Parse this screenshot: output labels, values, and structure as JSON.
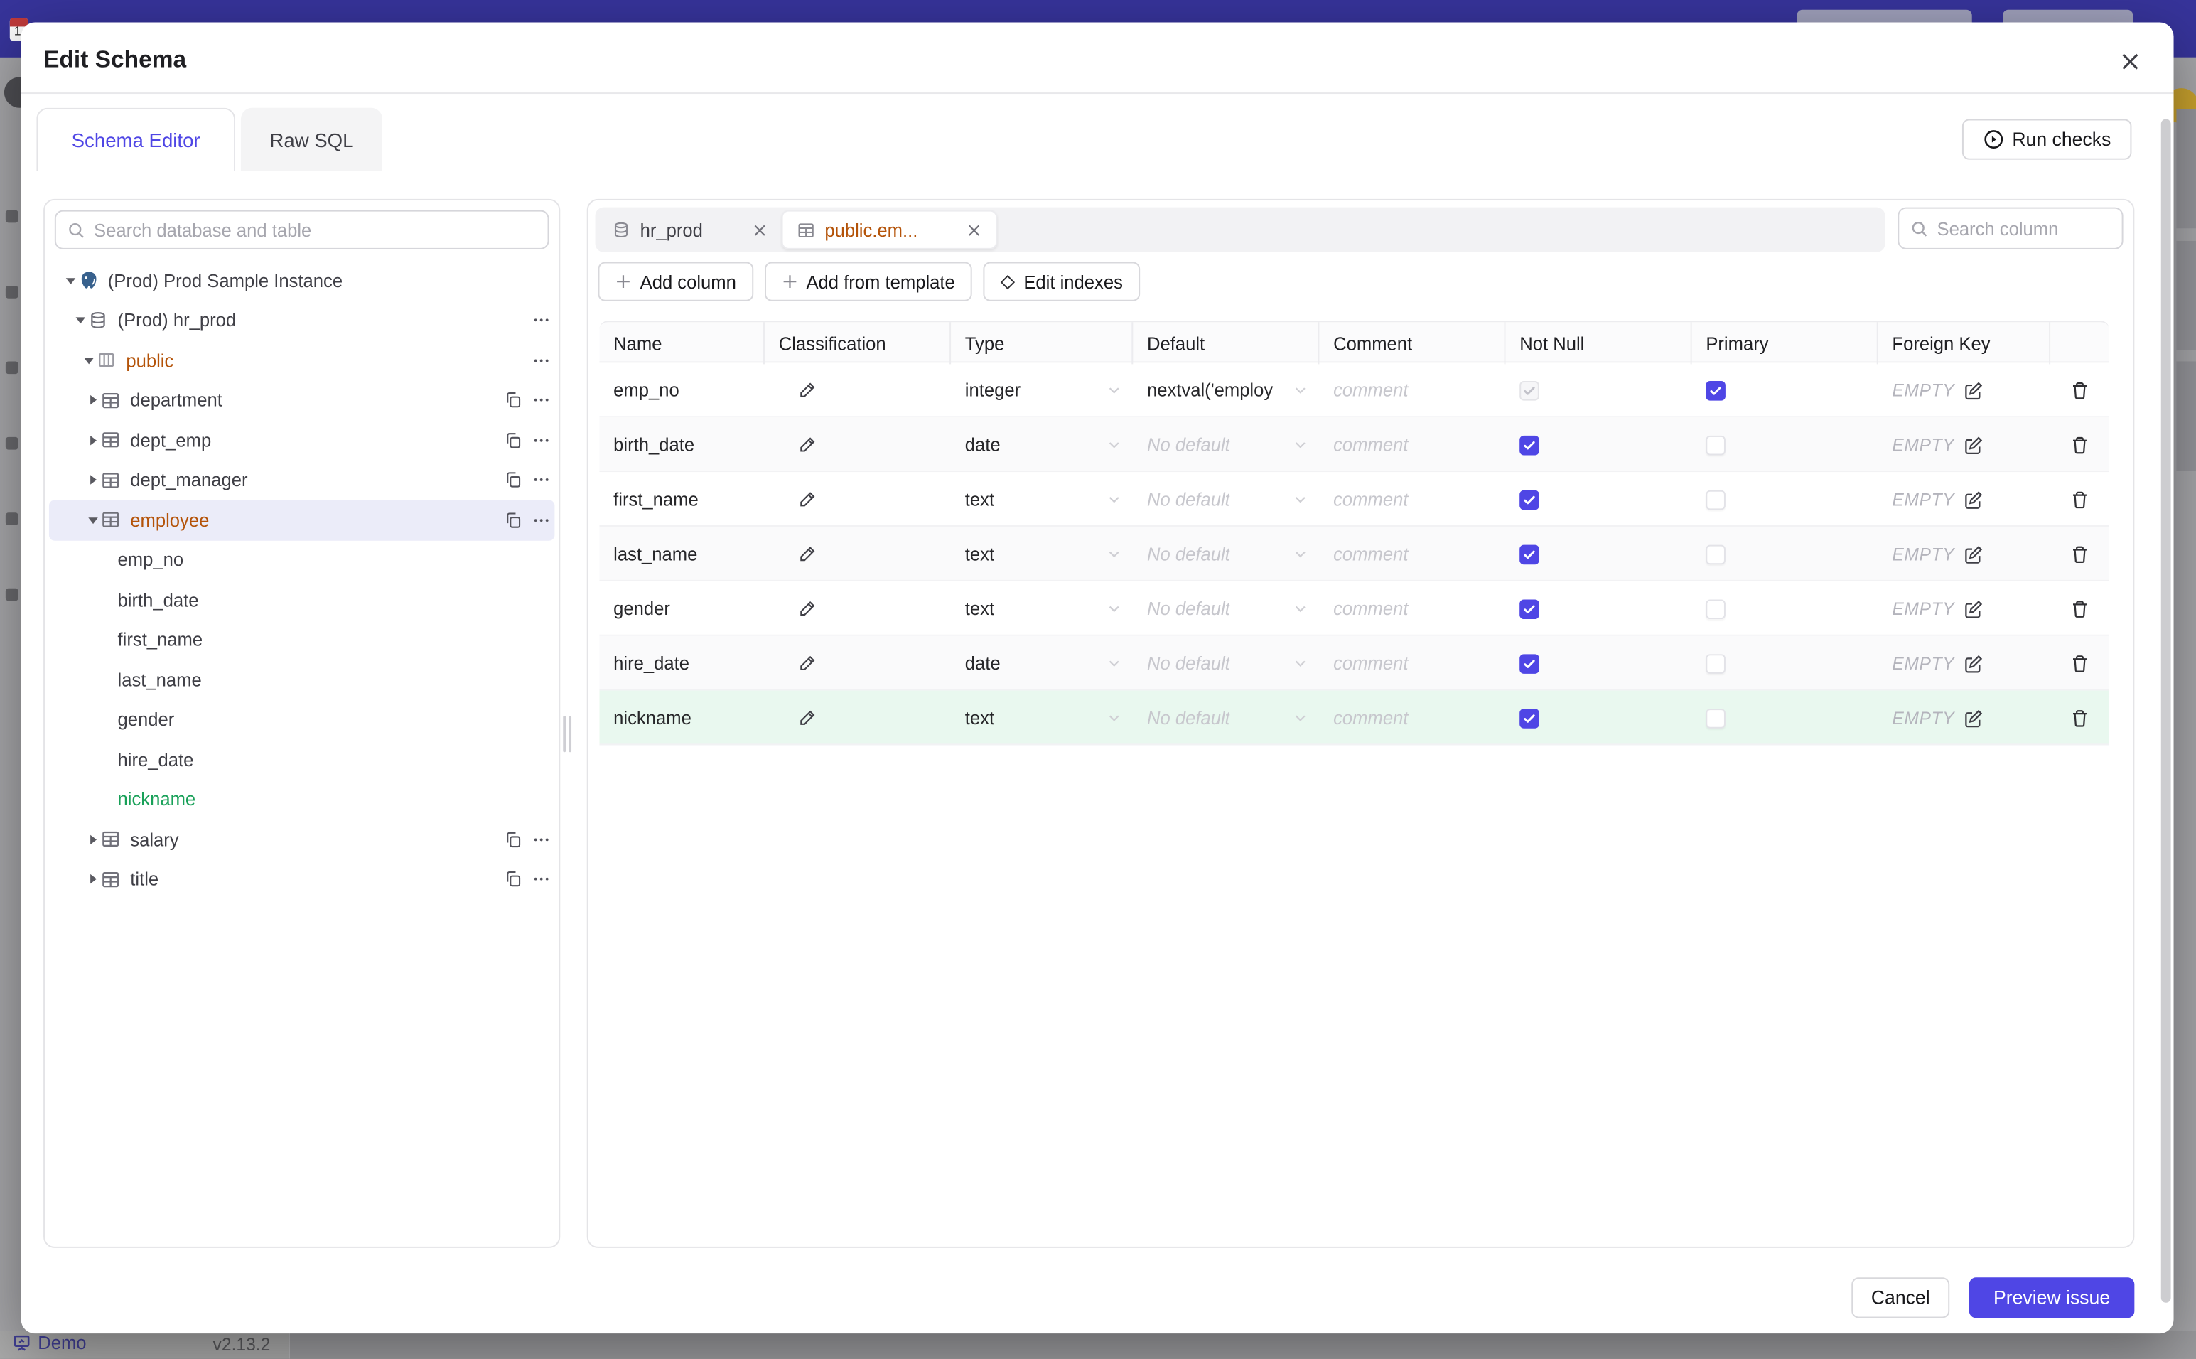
{
  "modal": {
    "title": "Edit Schema"
  },
  "header_tabs": {
    "schema_editor": "Schema Editor",
    "raw_sql": "Raw SQL"
  },
  "run_checks_label": "Run checks",
  "sidebar": {
    "search_placeholder": "Search database and table",
    "tree": [
      {
        "level": 0,
        "caret": "down",
        "icon": "postgres",
        "label": "(Prod) Prod Sample Instance",
        "color": "default",
        "selected": false,
        "actions": []
      },
      {
        "level": 1,
        "caret": "down",
        "icon": "database",
        "label": "(Prod) hr_prod",
        "color": "default",
        "selected": false,
        "actions": [
          "menu"
        ]
      },
      {
        "level": 2,
        "caret": "down",
        "icon": "schema",
        "label": "public",
        "color": "amber",
        "selected": false,
        "actions": [
          "menu"
        ]
      },
      {
        "level": 3,
        "caret": "right",
        "icon": "table",
        "label": "department",
        "color": "default",
        "selected": false,
        "actions": [
          "copy",
          "menu"
        ]
      },
      {
        "level": 3,
        "caret": "right",
        "icon": "table",
        "label": "dept_emp",
        "color": "default",
        "selected": false,
        "actions": [
          "copy",
          "menu"
        ]
      },
      {
        "level": 3,
        "caret": "right",
        "icon": "table",
        "label": "dept_manager",
        "color": "default",
        "selected": false,
        "actions": [
          "copy",
          "menu"
        ]
      },
      {
        "level": 3,
        "caret": "down",
        "icon": "table",
        "label": "employee",
        "color": "amber",
        "selected": true,
        "actions": [
          "copy",
          "menu"
        ]
      },
      {
        "level": 4,
        "caret": null,
        "icon": null,
        "label": "emp_no",
        "color": "default",
        "selected": false,
        "actions": []
      },
      {
        "level": 4,
        "caret": null,
        "icon": null,
        "label": "birth_date",
        "color": "default",
        "selected": false,
        "actions": []
      },
      {
        "level": 4,
        "caret": null,
        "icon": null,
        "label": "first_name",
        "color": "default",
        "selected": false,
        "actions": []
      },
      {
        "level": 4,
        "caret": null,
        "icon": null,
        "label": "last_name",
        "color": "default",
        "selected": false,
        "actions": []
      },
      {
        "level": 4,
        "caret": null,
        "icon": null,
        "label": "gender",
        "color": "default",
        "selected": false,
        "actions": []
      },
      {
        "level": 4,
        "caret": null,
        "icon": null,
        "label": "hire_date",
        "color": "default",
        "selected": false,
        "actions": []
      },
      {
        "level": 4,
        "caret": null,
        "icon": null,
        "label": "nickname",
        "color": "green",
        "selected": false,
        "actions": []
      },
      {
        "level": 3,
        "caret": "right",
        "icon": "table",
        "label": "salary",
        "color": "default",
        "selected": false,
        "actions": [
          "copy",
          "menu"
        ]
      },
      {
        "level": 3,
        "caret": "right",
        "icon": "table",
        "label": "title",
        "color": "default",
        "selected": false,
        "actions": [
          "copy",
          "menu"
        ]
      }
    ]
  },
  "editor": {
    "tabs": [
      {
        "label": "hr_prod",
        "icon": "database",
        "active": false
      },
      {
        "label": "public.em...",
        "icon": "table",
        "active": true
      }
    ],
    "search_placeholder": "Search column",
    "actions": [
      {
        "icon": "plus",
        "label": "Add column"
      },
      {
        "icon": "plus",
        "label": "Add from template"
      },
      {
        "icon": "diamond",
        "label": "Edit indexes"
      }
    ],
    "table": {
      "columns": [
        "Name",
        "Classification",
        "Type",
        "Default",
        "Comment",
        "Not Null",
        "Primary",
        "Foreign Key",
        ""
      ],
      "comment_placeholder": "comment",
      "rows": [
        {
          "name": "emp_no",
          "type": "integer",
          "default": "nextval('employ",
          "default_is_placeholder": false,
          "not_null": "on-disabled",
          "primary": "on",
          "foreign_key": "EMPTY",
          "added": false
        },
        {
          "name": "birth_date",
          "type": "date",
          "default": "No default",
          "default_is_placeholder": true,
          "not_null": "on",
          "primary": "off",
          "foreign_key": "EMPTY",
          "added": false
        },
        {
          "name": "first_name",
          "type": "text",
          "default": "No default",
          "default_is_placeholder": true,
          "not_null": "on",
          "primary": "off",
          "foreign_key": "EMPTY",
          "added": false
        },
        {
          "name": "last_name",
          "type": "text",
          "default": "No default",
          "default_is_placeholder": true,
          "not_null": "on",
          "primary": "off",
          "foreign_key": "EMPTY",
          "added": false
        },
        {
          "name": "gender",
          "type": "text",
          "default": "No default",
          "default_is_placeholder": true,
          "not_null": "on",
          "primary": "off",
          "foreign_key": "EMPTY",
          "added": false
        },
        {
          "name": "hire_date",
          "type": "date",
          "default": "No default",
          "default_is_placeholder": true,
          "not_null": "on",
          "primary": "off",
          "foreign_key": "EMPTY",
          "added": false
        },
        {
          "name": "nickname",
          "type": "text",
          "default": "No default",
          "default_is_placeholder": true,
          "not_null": "on",
          "primary": "off",
          "foreign_key": "EMPTY",
          "added": true
        }
      ]
    }
  },
  "footer": {
    "cancel_label": "Cancel",
    "submit_label": "Preview issue"
  },
  "statusbar": {
    "brand": "Demo",
    "version": "v2.13.2"
  },
  "colors": {
    "accent": "#4f46e5",
    "schema_highlight": "#b45309",
    "added_text": "#18a058",
    "added_row_bg": "#e9f8ef",
    "topbar": "#37349b"
  }
}
